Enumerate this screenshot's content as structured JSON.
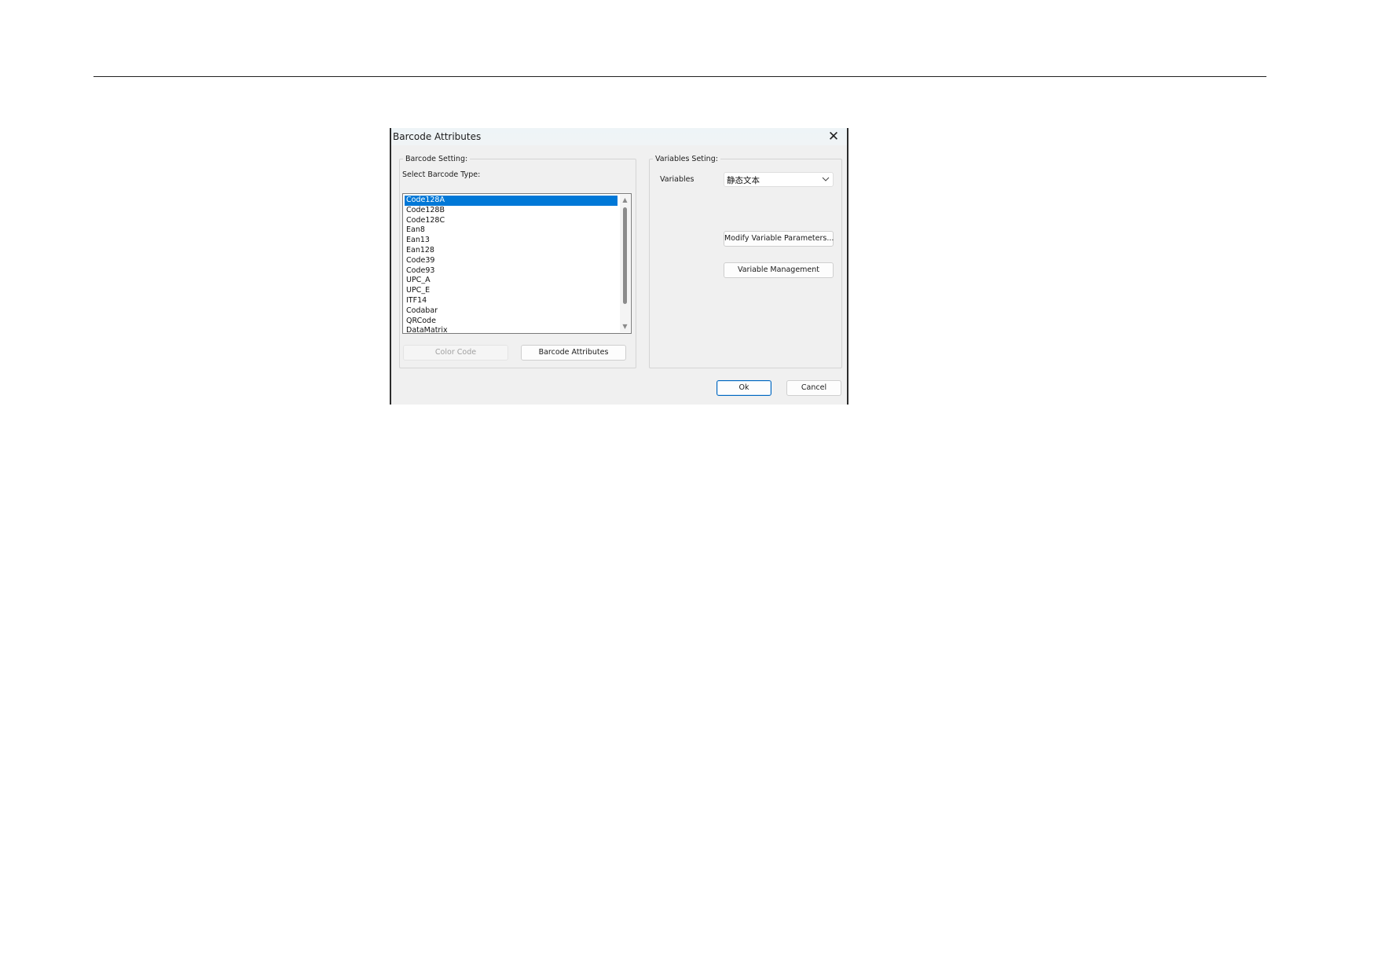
{
  "dialog": {
    "title": "Barcode Attributes",
    "close_symbol": "✕"
  },
  "barcode_setting": {
    "group_label": "Barcode Setting:",
    "select_type_label": "Select Barcode Type:",
    "types": [
      {
        "label": "Code128A",
        "selected": true
      },
      {
        "label": "Code128B",
        "selected": false
      },
      {
        "label": "Code128C",
        "selected": false
      },
      {
        "label": "Ean8",
        "selected": false
      },
      {
        "label": "Ean13",
        "selected": false
      },
      {
        "label": "Ean128",
        "selected": false
      },
      {
        "label": "Code39",
        "selected": false
      },
      {
        "label": "Code93",
        "selected": false
      },
      {
        "label": "UPC_A",
        "selected": false
      },
      {
        "label": "UPC_E",
        "selected": false
      },
      {
        "label": "ITF14",
        "selected": false
      },
      {
        "label": "Codabar",
        "selected": false
      },
      {
        "label": "QRCode",
        "selected": false
      },
      {
        "label": "DataMatrix",
        "selected": false
      }
    ],
    "color_code_label": "Color Code",
    "barcode_attributes_label": "Barcode Attributes"
  },
  "variables_setting": {
    "group_label": "Variables Seting:",
    "variables_label": "Variables",
    "variables_value": "静态文本",
    "modify_params_label": "Modify Variable Parameters...",
    "management_label": "Variable Management"
  },
  "footer": {
    "ok_label": "Ok",
    "cancel_label": "Cancel"
  },
  "colors": {
    "selection": "#0078d7",
    "dialog_bg": "#f0f0f0",
    "primary_border": "#0067c0"
  },
  "icons": {
    "close": "close-icon",
    "dropdown": "chevron-down-icon",
    "scroll_up": "scroll-up-arrow-icon",
    "scroll_down": "scroll-down-arrow-icon"
  }
}
